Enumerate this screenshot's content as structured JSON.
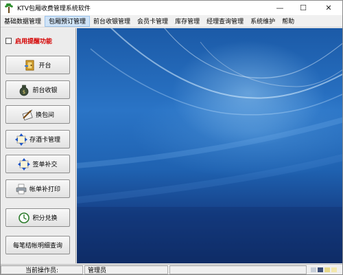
{
  "window": {
    "title": "KTV包厢收费管理系统软件",
    "controls": {
      "minimize": "—",
      "maximize": "☐",
      "close": "✕"
    }
  },
  "menu": {
    "items": [
      {
        "label": "基础数据管理",
        "active": false
      },
      {
        "label": "包厢预订管理",
        "active": true
      },
      {
        "label": "前台收银管理",
        "active": false
      },
      {
        "label": "会员卡管理",
        "active": false
      },
      {
        "label": "库存管理",
        "active": false
      },
      {
        "label": "经理查询管理",
        "active": false
      },
      {
        "label": "系统维护",
        "active": false
      },
      {
        "label": "帮助",
        "active": false
      }
    ]
  },
  "sidebar": {
    "reminder_label": "启用提醒功能",
    "reminder_checked": false,
    "buttons": [
      {
        "label": "开台",
        "icon": "open-room-icon"
      },
      {
        "label": "前台收银",
        "icon": "money-bag-icon"
      },
      {
        "label": "换包间",
        "icon": "swap-room-icon"
      },
      {
        "label": "存酒卡管理",
        "icon": "wine-card-icon"
      },
      {
        "label": "签单补交",
        "icon": "bill-pay-icon"
      },
      {
        "label": "帐单补打印",
        "icon": "printer-icon"
      },
      {
        "label": "积分兑换",
        "icon": "points-icon"
      },
      {
        "label": "每笔结帐明细查询",
        "icon": ""
      }
    ]
  },
  "statusbar": {
    "operator_label": "当前操作员:",
    "operator_value": "管理员",
    "block_colors": [
      "#c7ced9",
      "#3c4f77",
      "#e7d98b",
      "#f3e8ad"
    ]
  },
  "colors": {
    "desktop_top": "#1b5aa7",
    "desktop_bottom": "#102f6a",
    "reminder_red": "#d40000",
    "menu_active": "#cfe3f7"
  }
}
